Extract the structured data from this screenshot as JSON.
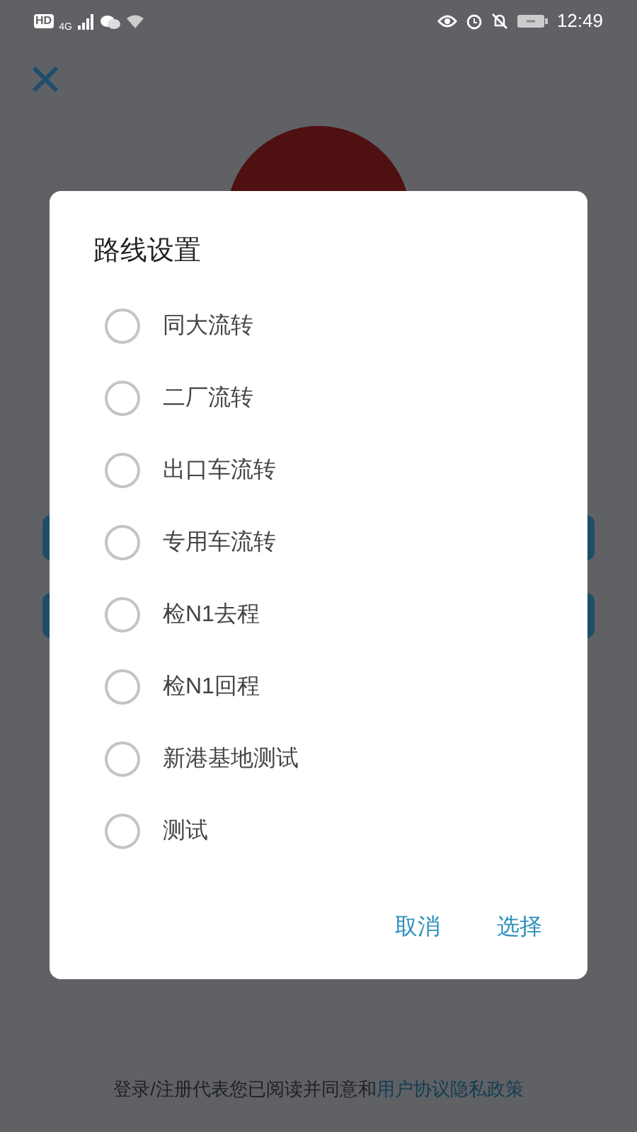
{
  "status_bar": {
    "time": "12:49",
    "network": "4G",
    "hd": "HD"
  },
  "dialog": {
    "title": "路线设置",
    "options": [
      {
        "label": "同大流转",
        "selected": false
      },
      {
        "label": "二厂流转",
        "selected": false
      },
      {
        "label": "出口车流转",
        "selected": false
      },
      {
        "label": "专用车流转",
        "selected": false
      },
      {
        "label": "检N1去程",
        "selected": false
      },
      {
        "label": "检N1回程",
        "selected": false
      },
      {
        "label": "新港基地测试",
        "selected": false
      },
      {
        "label": "测试",
        "selected": false
      }
    ],
    "buttons": [
      "取消",
      "选择"
    ]
  },
  "footer": {
    "text": "登录/注册代表您已阅读并同意和",
    "link": "用户协议隐私政策"
  }
}
